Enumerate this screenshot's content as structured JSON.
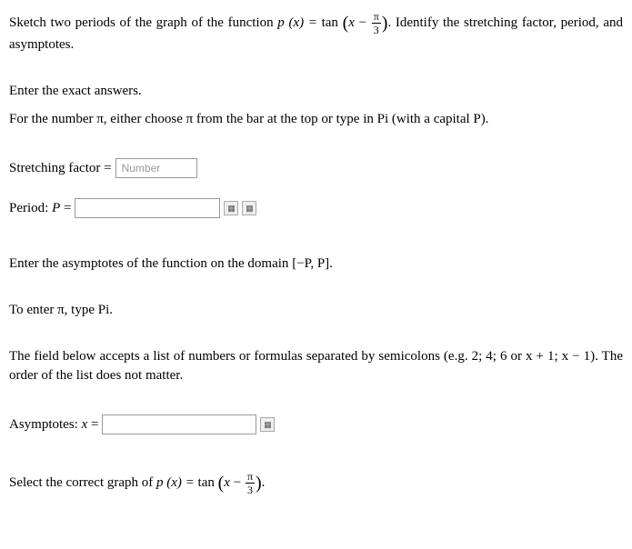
{
  "intro": {
    "prefix": "Sketch two periods of the graph of the function ",
    "func_lhs": "p (x) = ",
    "func_op": "tan",
    "paren_open": "(",
    "var": "x",
    "minus": " − ",
    "frac_num": "π",
    "frac_den": "3",
    "paren_close": ")",
    "suffix": ". Identify the stretching factor, period, and asymptotes."
  },
  "instructions": {
    "exact": "Enter the exact answers.",
    "pi_note": "For the number π, either choose π from the bar at the top or type in Pi (with a capital P)."
  },
  "fields": {
    "stretch_label": "Stretching factor = ",
    "stretch_placeholder": "Number",
    "period_label_prefix": "Period: ",
    "period_var": "P",
    "period_eq": " = "
  },
  "asymptote_section": {
    "intro_prefix": "Enter the asymptotes of the function on the domain ",
    "domain": "[−P, P]",
    "period_after": ".",
    "pi_note": "To enter π, type Pi.",
    "list_note": "The field below accepts a list of numbers or formulas separated by semicolons (e.g. 2; 4; 6 or x + 1; x − 1). The order of the list does not matter.",
    "asym_label_prefix": "Asymptotes: ",
    "asym_var": "x",
    "asym_eq": " = "
  },
  "graph_select": {
    "prefix": "Select the correct graph of ",
    "func_lhs": "p (x) = ",
    "func_op": "tan",
    "paren_open": "(",
    "var": "x",
    "minus": " − ",
    "frac_num": "π",
    "frac_den": "3",
    "paren_close": ")",
    "suffix": "."
  }
}
